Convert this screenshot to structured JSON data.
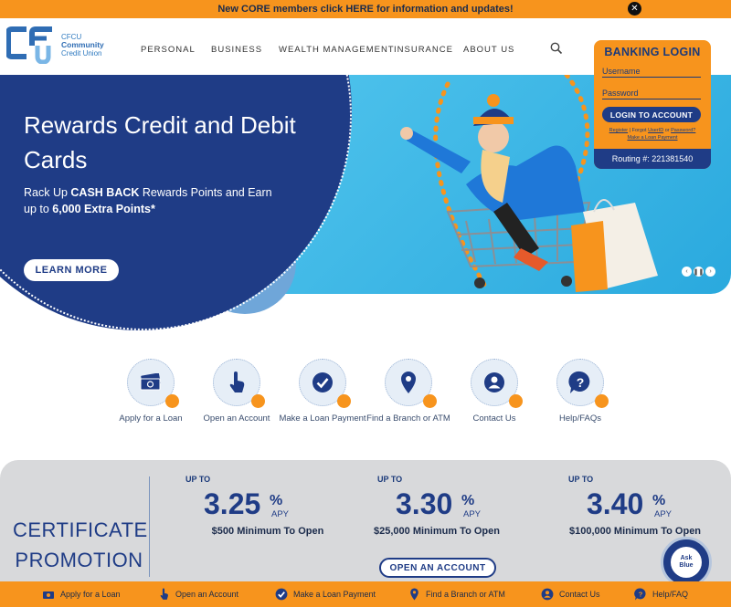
{
  "banner": {
    "text": "New CORE members click HERE for information and updates!",
    "close_icon": "✕"
  },
  "logo": {
    "abbr": "CFCU",
    "line1": "Community",
    "line2": "Credit Union"
  },
  "nav": [
    "PERSONAL",
    "BUSINESS",
    "WEALTH MANAGEMENT",
    "INSURANCE",
    "ABOUT US"
  ],
  "hero": {
    "title": "Rewards Credit and Debit Cards",
    "sub_prefix": "Rack Up ",
    "sub_bold1": "CASH BACK",
    "sub_mid": " Rewards Points and Earn up to ",
    "sub_bold2": "6,000 Extra Points*",
    "cta": "LEARN MORE"
  },
  "login": {
    "title": "BANKING LOGIN",
    "username_placeholder": "Username",
    "password_placeholder": "Password",
    "button": "LOGIN TO ACCOUNT",
    "link_register": "Register",
    "link_forgot": "Forgot",
    "link_userid": "UserID",
    "link_or": "or",
    "link_password": "Password?",
    "link_loan": "Make a Loan Payment",
    "routing": "Routing #: 221381540"
  },
  "quick_links": [
    {
      "label": "Apply for a Loan",
      "icon": "money-icon"
    },
    {
      "label": "Open an Account",
      "icon": "pointer-icon"
    },
    {
      "label": "Make a Loan Payment",
      "icon": "check-icon"
    },
    {
      "label": "Find a Branch or ATM",
      "icon": "location-icon"
    },
    {
      "label": "Contact Us",
      "icon": "person-icon"
    },
    {
      "label": "Help/FAQs",
      "icon": "question-icon"
    }
  ],
  "certificate": {
    "title_line1": "CERTIFICATE",
    "title_line2": "PROMOTION",
    "rates": [
      {
        "up_to": "UP TO",
        "value": "3.25",
        "pct": "%",
        "apy": "APY",
        "min": "$500 Minimum To Open"
      },
      {
        "up_to": "UP TO",
        "value": "3.30",
        "pct": "%",
        "apy": "APY",
        "min": "$25,000 Minimum To Open"
      },
      {
        "up_to": "UP TO",
        "value": "3.40",
        "pct": "%",
        "apy": "APY",
        "min": "$100,000 Minimum To Open"
      }
    ],
    "cta": "OPEN AN ACCOUNT"
  },
  "ask": {
    "line1": "Ask",
    "line2": "Blue"
  },
  "bottom_bar": [
    {
      "label": "Apply for a Loan",
      "icon": "money-icon"
    },
    {
      "label": "Open an Account",
      "icon": "pointer-icon"
    },
    {
      "label": "Make a Loan Payment",
      "icon": "check-icon"
    },
    {
      "label": "Find a Branch or ATM",
      "icon": "location-icon"
    },
    {
      "label": "Contact Us",
      "icon": "person-icon"
    },
    {
      "label": "Help/FAQ",
      "icon": "question-icon"
    }
  ],
  "colors": {
    "orange": "#f7941d",
    "navy": "#1f3c86",
    "sky": "#2aa9de",
    "grey": "#d8d9db"
  }
}
